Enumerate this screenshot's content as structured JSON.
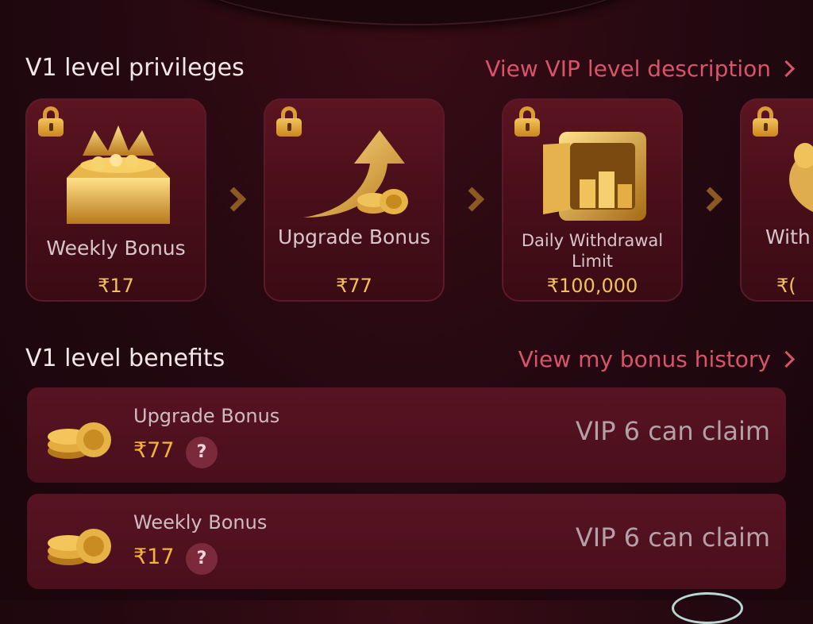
{
  "privileges": {
    "title": "V1 level privileges",
    "link": "View VIP level description",
    "items": [
      {
        "label": "Weekly Bonus",
        "value": "₹17",
        "icon": "treasure-chest-crown-icon"
      },
      {
        "label": "Upgrade Bonus",
        "value": "₹77",
        "icon": "arrow-up-coins-icon"
      },
      {
        "label": "Daily Withdrawal Limit",
        "value": "₹100,000",
        "icon": "vault-safe-icon"
      },
      {
        "label": "With",
        "value": "₹(",
        "icon": "piggy-bank-icon"
      }
    ]
  },
  "benefits": {
    "title": "V1 level benefits",
    "link": "View my bonus history",
    "items": [
      {
        "name": "Upgrade Bonus",
        "value": "₹77",
        "help": "?",
        "status": "VIP 6 can claim"
      },
      {
        "name": "Weekly Bonus",
        "value": "₹17",
        "help": "?",
        "status": "VIP 6 can claim"
      }
    ]
  },
  "colors": {
    "accent_link": "#d9536a",
    "gold_value": "#f2c25a",
    "card_border": "#5a1a2a",
    "background": "#220810"
  }
}
